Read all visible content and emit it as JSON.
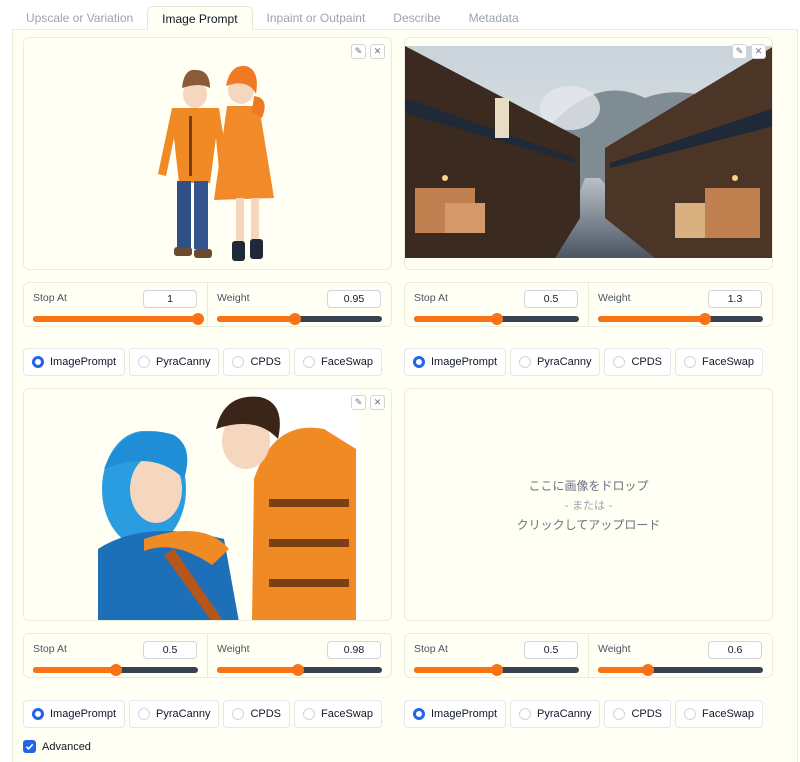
{
  "tabs": [
    {
      "label": "Upscale or Variation"
    },
    {
      "label": "Image Prompt",
      "active": true
    },
    {
      "label": "Inpaint or Outpaint"
    },
    {
      "label": "Describe"
    },
    {
      "label": "Metadata"
    }
  ],
  "slots": [
    {
      "image": "anime-couple-orange-coats",
      "stop_at_label": "Stop At",
      "stop_at": "1",
      "stop_at_fraction": 1.0,
      "weight_label": "Weight",
      "weight": "0.95",
      "weight_fraction": 0.475,
      "types": [
        "ImagePrompt",
        "PyraCanny",
        "CPDS",
        "FaceSwap"
      ],
      "selected": "ImagePrompt"
    },
    {
      "image": "japanese-street-scene",
      "stop_at_label": "Stop At",
      "stop_at": "0.5",
      "stop_at_fraction": 0.5,
      "weight_label": "Weight",
      "weight": "1.3",
      "weight_fraction": 0.65,
      "types": [
        "ImagePrompt",
        "PyraCanny",
        "CPDS",
        "FaceSwap"
      ],
      "selected": "ImagePrompt"
    },
    {
      "image": "anime-blue-hair-and-boy",
      "stop_at_label": "Stop At",
      "stop_at": "0.5",
      "stop_at_fraction": 0.5,
      "weight_label": "Weight",
      "weight": "0.98",
      "weight_fraction": 0.49,
      "types": [
        "ImagePrompt",
        "PyraCanny",
        "CPDS",
        "FaceSwap"
      ],
      "selected": "ImagePrompt"
    },
    {
      "image": null,
      "stop_at_label": "Stop At",
      "stop_at": "0.5",
      "stop_at_fraction": 0.5,
      "weight_label": "Weight",
      "weight": "0.6",
      "weight_fraction": 0.3,
      "types": [
        "ImagePrompt",
        "PyraCanny",
        "CPDS",
        "FaceSwap"
      ],
      "selected": "ImagePrompt"
    }
  ],
  "drop_zone": {
    "line1": "ここに画像をドロップ",
    "line2": "- または -",
    "line3": "クリックしてアップロード"
  },
  "advanced": {
    "label": "Advanced",
    "checked": true
  },
  "icons": {
    "edit": "pencil-icon",
    "close": "close-icon",
    "check": "check-icon"
  },
  "colors": {
    "accent": "#f97316",
    "radio": "#2563eb",
    "panel_bg": "#fffff4"
  }
}
